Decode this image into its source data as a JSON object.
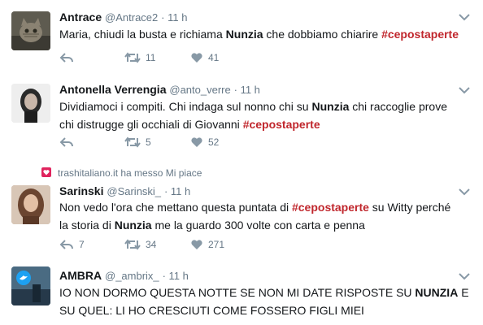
{
  "tweets": [
    {
      "name": "Antrace",
      "handle": "@Antrace2",
      "time": "· 11 h",
      "text_parts": [
        "Maria, chiudi la busta e richiama ",
        "Nunzia",
        " che dobbiamo chiarire ",
        "#cepostaperte"
      ],
      "replies": "",
      "retweets": "11",
      "likes": "41"
    },
    {
      "name": "Antonella Verrengia",
      "handle": "@anto_verre",
      "time": "· 11 h",
      "text_parts": [
        "Dividiamoci i compiti. Chi indaga sul nonno chi su ",
        "Nunzia",
        " chi raccoglie prove chi distrugge gli occhiali di Giovanni ",
        "#cepostaperte"
      ],
      "replies": "",
      "retweets": "5",
      "likes": "52"
    },
    {
      "context": "trashitaliano.it ha messo Mi piace",
      "name": "Sarinski",
      "handle": "@Sarinski_",
      "time": "· 11 h",
      "text_parts": [
        "Non vedo l'ora che mettano questa puntata di ",
        "#cepostaperte",
        " su Witty perché la storia di ",
        "Nunzia",
        " me la guardo 300 volte con carta e penna"
      ],
      "replies": "7",
      "retweets": "34",
      "likes": "271"
    },
    {
      "name": "AMBRA",
      "handle": "@_ambrix_",
      "time": "· 11 h",
      "text_parts": [
        "IO NON DORMO QUESTA NOTTE SE NON MI DATE RISPOSTE SU ",
        "NUNZIA",
        " E SU QUEL: LI HO CRESCIUTI COME FOSSERO FIGLI MIEI"
      ],
      "replies": "",
      "retweets": "",
      "likes": ""
    }
  ],
  "colors": {
    "hashtag": "#c0262c",
    "meta": "#657786",
    "icon": "#8899a6",
    "heart_badge": "#e0245e"
  }
}
